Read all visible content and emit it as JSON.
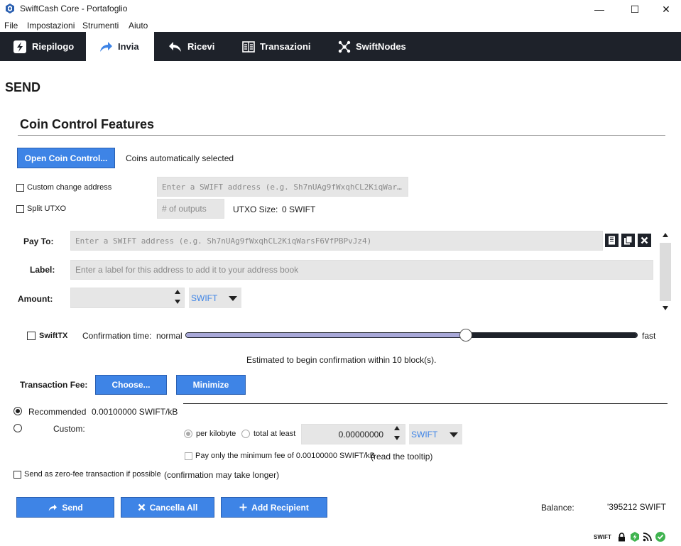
{
  "window": {
    "title": "SwiftCash Core - Portafoglio",
    "minimize": "—",
    "maximize": "☐",
    "close": "✕"
  },
  "menu": [
    "File",
    "Impostazioni",
    "Strumenti",
    "Aiuto"
  ],
  "tabs": [
    {
      "label": "Riepilogo",
      "icon": "summary-icon"
    },
    {
      "label": "Invia",
      "icon": "send-arrow-icon"
    },
    {
      "label": "Ricevi",
      "icon": "receive-arrow-icon"
    },
    {
      "label": "Transazioni",
      "icon": "transactions-icon"
    },
    {
      "label": "SwiftNodes",
      "icon": "nodes-icon"
    }
  ],
  "page_title": "SEND",
  "coin_control": {
    "title": "Coin Control Features",
    "open_button": "Open Coin Control...",
    "status": "Coins automatically selected",
    "custom_change_label": "Custom change address",
    "custom_change_placeholder": "Enter a SWIFT address (e.g. Sh7nUAg9fWxqhCL2KiqWar…",
    "split_utxo_label": "Split UTXO",
    "outputs_placeholder": "# of outputs",
    "utxo_size_label": "UTXO Size:",
    "utxo_size_value": "0 SWIFT"
  },
  "recipient": {
    "pay_to_label": "Pay To:",
    "pay_to_placeholder": "Enter a SWIFT address (e.g. Sh7nUAg9fWxqhCL2KiqWarsF6VfPBPvJz4)",
    "label_label": "Label:",
    "label_placeholder": "Enter a label for this address to add it to your address book",
    "amount_label": "Amount:",
    "amount_value": "",
    "unit": "SWIFT"
  },
  "swifttx": {
    "label": "SwiftTX",
    "confirmation_label": "Confirmation time:",
    "slow_label": "normal",
    "fast_label": "fast",
    "slider_fraction": 0.62,
    "estimate": "Estimated to begin confirmation within 10 block(s)."
  },
  "fee": {
    "label": "Transaction Fee:",
    "choose_button": "Choose...",
    "minimize_button": "Minimize",
    "recommended_label": "Recommended",
    "recommended_value": "0.00100000 SWIFT/kB",
    "custom_label": "Custom:",
    "per_kilobyte_label": "per kilobyte",
    "total_at_least_label": "total at least",
    "custom_value": "0.00000000",
    "unit": "SWIFT",
    "min_fee_label": "Pay only the minimum fee of 0.00100000 SWIFT/kB",
    "tooltip_hint": "(read the tooltip)",
    "zero_fee_label": "Send as zero-fee transaction if possible",
    "zero_fee_note": "(confirmation may take longer)"
  },
  "actions": {
    "send": "Send",
    "clear_all": "Cancella All",
    "add_recipient": "Add Recipient"
  },
  "balance": {
    "label": "Balance:",
    "value": "'395212 SWIFT"
  },
  "statusbar": {
    "unit": "SWIFT"
  },
  "colors": {
    "accent": "#3e84e6",
    "dark": "#1e222a",
    "ok": "#3fb34f"
  }
}
